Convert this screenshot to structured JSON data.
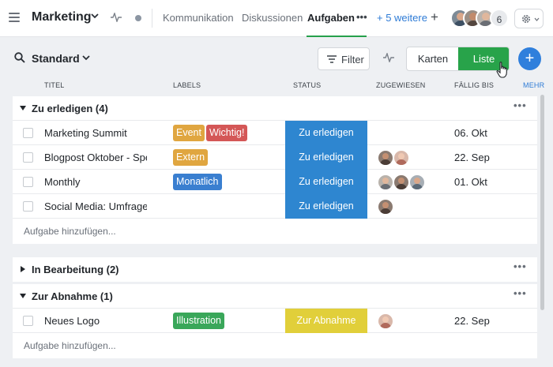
{
  "header": {
    "project_title": "Marketing",
    "tabs": [
      {
        "label": "Kommunikation"
      },
      {
        "label": "Diskussionen"
      },
      {
        "label": "Aufgaben"
      }
    ],
    "more_tabs": "+ 5 weitere",
    "add_tab": "+",
    "member_count": "6"
  },
  "toolbar": {
    "view_name": "Standard",
    "filter_label": "Filter",
    "view_cards": "Karten",
    "view_list": "Liste",
    "add": "+"
  },
  "columns": {
    "title": "TITEL",
    "labels": "LABELS",
    "status": "STATUS",
    "assigned": "ZUGEWIESEN",
    "due": "FÄLLIG BIS",
    "more": "MEHR"
  },
  "colors": {
    "accent_green": "#28a34a",
    "accent_blue": "#2f7fdc",
    "status_todo": "#2e86d0",
    "status_review": "#e1cf3a"
  },
  "groups": {
    "todo": {
      "name": "Zu erledigen (4)",
      "add_task": "Aufgabe hinzufügen...",
      "rows": [
        {
          "title": "Marketing Summit",
          "labels": [
            {
              "text": "Event",
              "color": "#e0a640"
            },
            {
              "text": "Wichtig!",
              "color": "#d45757"
            }
          ],
          "status": "Zu erledigen",
          "due": "06. Okt"
        },
        {
          "title": "Blogpost Oktober - Speci...",
          "labels": [
            {
              "text": "Extern",
              "color": "#e0a640"
            }
          ],
          "status": "Zu erledigen",
          "due": "22. Sep"
        },
        {
          "title": "Monthly",
          "labels": [
            {
              "text": "Monatlich",
              "color": "#3a7fd0"
            }
          ],
          "status": "Zu erledigen",
          "due": "01. Okt"
        },
        {
          "title": "Social Media: Umfrage",
          "labels": [],
          "status": "Zu erledigen",
          "due": ""
        }
      ]
    },
    "in_progress": {
      "name": "In Bearbeitung (2)"
    },
    "review": {
      "name": "Zur Abnahme (1)",
      "add_task": "Aufgabe hinzufügen...",
      "rows": [
        {
          "title": "Neues Logo",
          "labels": [
            {
              "text": "Illustration",
              "color": "#3aa75a"
            }
          ],
          "status": "Zur Abnahme",
          "due": "22. Sep"
        }
      ]
    }
  }
}
